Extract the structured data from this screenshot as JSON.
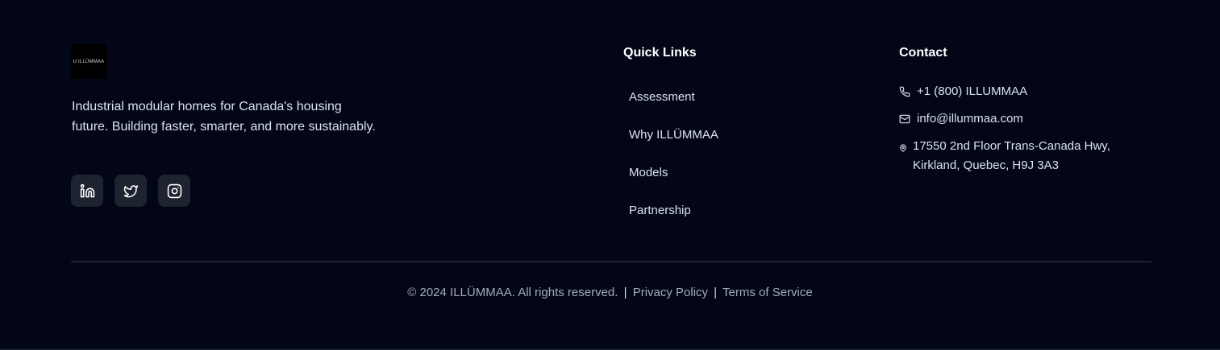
{
  "brand": {
    "logo_text": "U ILLÜMMAA",
    "tagline": "Industrial modular homes for Canada's housing future. Building faster, smarter, and more sustainably."
  },
  "socials": [
    {
      "name": "linkedin",
      "icon": "linkedin-icon"
    },
    {
      "name": "twitter",
      "icon": "twitter-icon"
    },
    {
      "name": "instagram",
      "icon": "instagram-icon"
    }
  ],
  "quick_links": {
    "title": "Quick Links",
    "items": [
      "Assessment",
      "Why ILLÜMMAA",
      "Models",
      "Partnership"
    ]
  },
  "contact": {
    "title": "Contact",
    "phone": "+1 (800) ILLUMMAA",
    "email": "info@illummaa.com",
    "address_line1": "17550 2nd Floor Trans-Canada Hwy,",
    "address_line2": "Kirkland, Quebec, H9J 3A3"
  },
  "bottom": {
    "copyright": "© 2024 ILLÜMMAA. All rights reserved.",
    "separator": "|",
    "privacy": "Privacy Policy",
    "terms": "Terms of Service"
  },
  "colors": {
    "background": "#020617",
    "social_button_bg": "#1e2330",
    "text": "#dbe2ec",
    "muted_text": "#a3aab8"
  }
}
